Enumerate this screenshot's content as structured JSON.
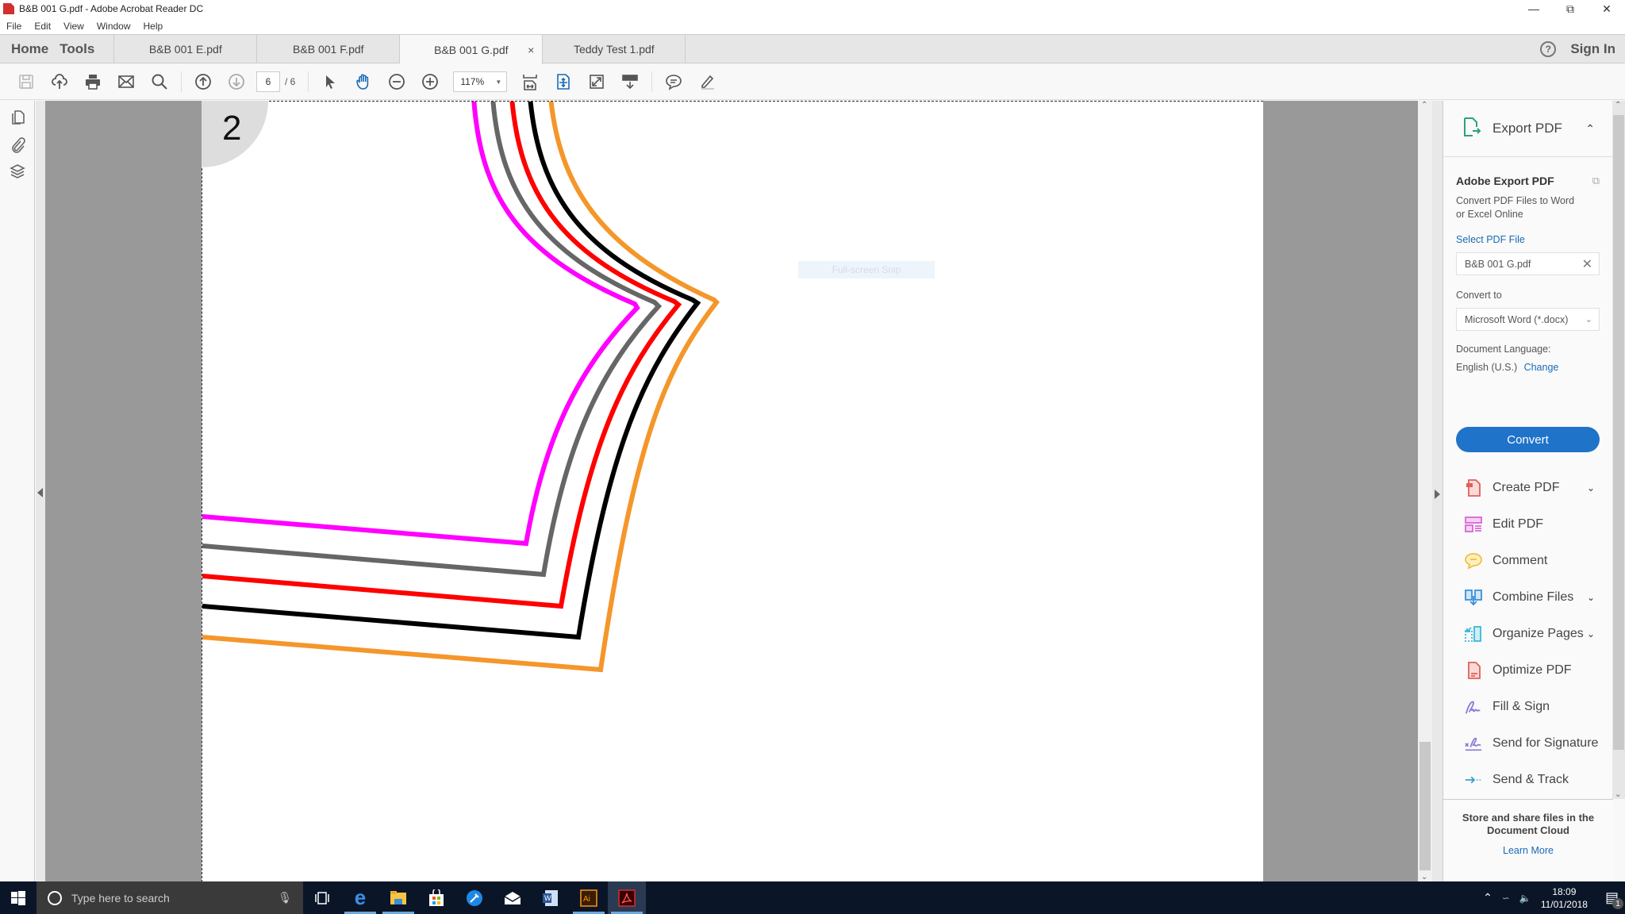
{
  "window": {
    "title": "B&B 001 G.pdf - Adobe Acrobat Reader DC",
    "controls": [
      "minimize",
      "restore",
      "close"
    ]
  },
  "menu": [
    "File",
    "Edit",
    "View",
    "Window",
    "Help"
  ],
  "tabs": {
    "home": "Home",
    "tools": "Tools",
    "documents": [
      {
        "label": "B&B 001 E.pdf",
        "active": false
      },
      {
        "label": "B&B 001 F.pdf",
        "active": false
      },
      {
        "label": "B&B 001 G.pdf",
        "active": true
      },
      {
        "label": "Teddy Test 1.pdf",
        "active": false
      }
    ],
    "close_glyph": "×",
    "help_glyph": "?",
    "sign_in": "Sign In"
  },
  "toolbar": {
    "current_page": "6",
    "total_pages": "/ 6",
    "zoom": "117%",
    "icons": [
      "save-icon",
      "upload-icon",
      "print-icon",
      "email-icon",
      "search-icon",
      "page-up-icon",
      "page-down-icon",
      "select-pointer-icon",
      "hand-tool-icon",
      "zoom-out-icon",
      "zoom-in-icon",
      "fit-page-icon",
      "scroll-mode-icon",
      "full-screen-icon",
      "read-mode-icon",
      "comment-icon",
      "highlight-pen-icon"
    ]
  },
  "document": {
    "page_badge": "2",
    "overlay_hint": "Full-screen Snip",
    "line_colors": [
      "#ff00ff",
      "#666666",
      "#ff0000",
      "#000000",
      "#f5962a"
    ]
  },
  "right_panel": {
    "header": "Export PDF",
    "section_title": "Adobe Export PDF",
    "description": "Convert PDF Files to Word or Excel Online",
    "select_file_link": "Select PDF File",
    "selected_file": "B&B 001 G.pdf",
    "convert_to_label": "Convert to",
    "convert_to_value": "Microsoft Word (*.docx)",
    "doc_language_label": "Document Language:",
    "doc_language_value": "English (U.S.)",
    "change_link": "Change",
    "convert_button": "Convert",
    "tools": [
      {
        "label": "Create PDF",
        "expandable": true,
        "color": "#e0605a"
      },
      {
        "label": "Edit PDF",
        "expandable": false,
        "color": "#d966d6"
      },
      {
        "label": "Comment",
        "expandable": false,
        "color": "#f0c040"
      },
      {
        "label": "Combine Files",
        "expandable": true,
        "color": "#3a8fd8"
      },
      {
        "label": "Organize Pages",
        "expandable": true,
        "color": "#3bb8d8"
      },
      {
        "label": "Optimize PDF",
        "expandable": false,
        "color": "#e0605a"
      },
      {
        "label": "Fill & Sign",
        "expandable": false,
        "color": "#8a78d8"
      },
      {
        "label": "Send for Signature",
        "expandable": false,
        "color": "#8a78d8"
      },
      {
        "label": "Send & Track",
        "expandable": false,
        "color": "#3aa0d0"
      }
    ],
    "footer_message": "Store and share files in the Document Cloud",
    "footer_link": "Learn More"
  },
  "taskbar": {
    "search_placeholder": "Type here to search",
    "apps": [
      "task-view",
      "edge",
      "file-explorer",
      "store",
      "app-blue",
      "mail",
      "word",
      "illustrator",
      "acrobat"
    ],
    "time": "18:09",
    "date": "11/01/2018",
    "notification_count": "1"
  }
}
